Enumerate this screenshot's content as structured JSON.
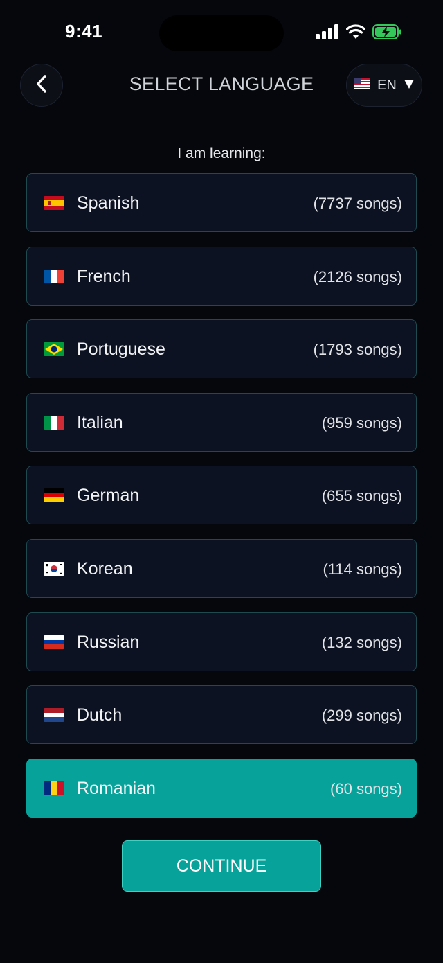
{
  "status_bar": {
    "time": "9:41",
    "icons": [
      "signal-icon",
      "wifi-icon",
      "battery-charging-icon"
    ]
  },
  "header": {
    "back_icon": "chevron-left-icon",
    "title": "SELECT LANGUAGE",
    "ui_language": {
      "flag": "us",
      "code": "EN",
      "dropdown_icon": "triangle-down-icon"
    }
  },
  "prompt": "I am learning:",
  "languages": [
    {
      "flag": "es",
      "name": "Spanish",
      "count": "(7737 songs)",
      "selected": false
    },
    {
      "flag": "fr",
      "name": "French",
      "count": "(2126 songs)",
      "selected": false
    },
    {
      "flag": "br",
      "name": "Portuguese",
      "count": "(1793 songs)",
      "selected": false
    },
    {
      "flag": "it",
      "name": "Italian",
      "count": "(959 songs)",
      "selected": false
    },
    {
      "flag": "de",
      "name": "German",
      "count": "(655 songs)",
      "selected": false
    },
    {
      "flag": "kr",
      "name": "Korean",
      "count": "(114 songs)",
      "selected": false
    },
    {
      "flag": "ru",
      "name": "Russian",
      "count": "(132 songs)",
      "selected": false
    },
    {
      "flag": "nl",
      "name": "Dutch",
      "count": "(299 songs)",
      "selected": false
    },
    {
      "flag": "ro",
      "name": "Romanian",
      "count": "(60 songs)",
      "selected": true
    }
  ],
  "continue_label": "CONTINUE",
  "colors": {
    "background": "#05070c",
    "row_background": "#0c1222",
    "row_border": "#1e4a50",
    "accent": "#07a39a"
  }
}
